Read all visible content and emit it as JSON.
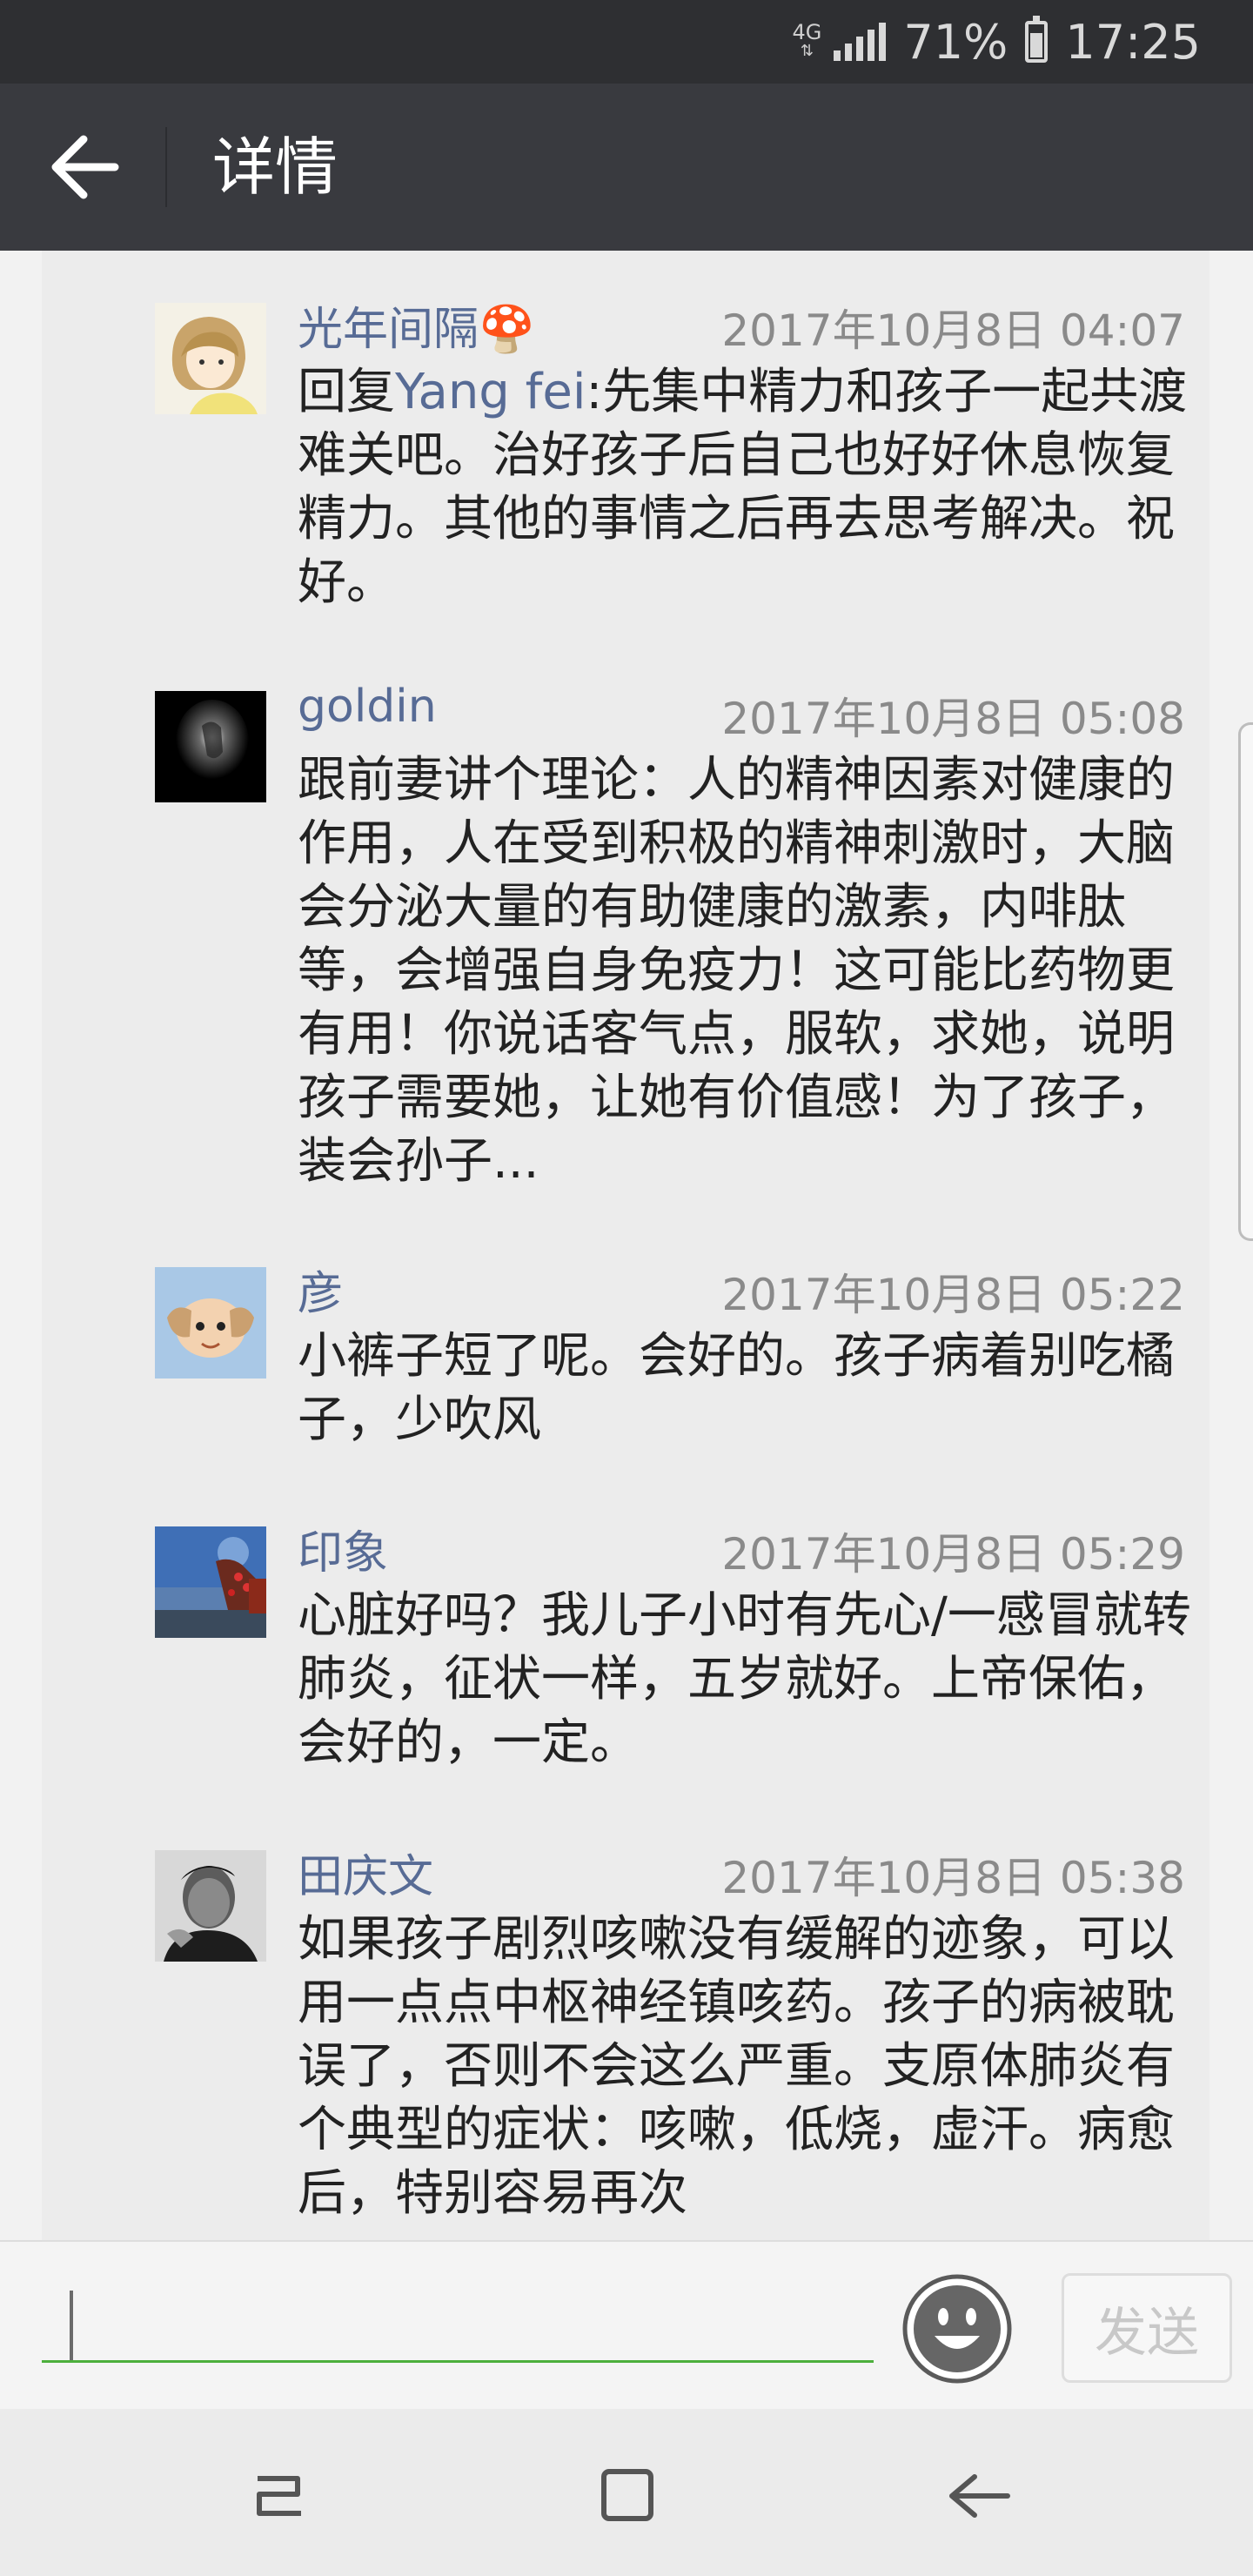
{
  "status_bar": {
    "network": "4G",
    "battery": "71%",
    "battery_level": 0.71,
    "time": "17:25"
  },
  "header": {
    "title": "详情"
  },
  "comments": [
    {
      "nickname": "光年间隔🍄",
      "time": "2017年10月8日 04:07",
      "reply_prefix": "回复",
      "reply_to": "Yang fei",
      "text": ":先集中精力和孩子一起共渡难关吧。治好孩子后自己也好好休息恢复精力。其他的事情之后再去思考解决。祝好。",
      "avatar": "cartoon-girl-avatar"
    },
    {
      "nickname": "goldin",
      "time": "2017年10月8日 05:08",
      "text": "跟前妻讲个理论：人的精神因素对健康的作用，人在受到积极的精神刺激时，大脑会分泌大量的有助健康的激素，内啡肽等，会增强自身免疫力！这可能比药物更有用！你说话客气点，服软，求她，说明孩子需要她，让她有价值感！为了孩子，装会孙子...",
      "avatar": "dark-hand-avatar"
    },
    {
      "nickname": "彦",
      "time": "2017年10月8日 05:22",
      "text": "小裤子短了呢。会好的。孩子病着别吃橘子，少吹风",
      "avatar": "cartoon-character-avatar"
    },
    {
      "nickname": "印象",
      "time": "2017年10月8日 05:29",
      "text": "心脏好吗？我儿子小时有先心/一感冒就转肺炎，征状一样，五岁就好。上帝保佑，会好的，一定。",
      "avatar": "landscape-avatar"
    },
    {
      "nickname": "田庆文",
      "time": "2017年10月8日 05:38",
      "text": "如果孩子剧烈咳嗽没有缓解的迹象，可以用一点点中枢神经镇咳药。孩子的病被耽误了，否则不会这么严重。支原体肺炎有个典型的症状：咳嗽，低烧，虚汗。病愈后，特别容易再次",
      "avatar": "man-portrait-avatar"
    }
  ],
  "input_bar": {
    "send_label": "发送",
    "emoji_icon": "smiley-icon"
  },
  "nav_bar": {
    "icons": [
      "recent-apps-icon",
      "home-icon",
      "back-icon"
    ]
  },
  "colors": {
    "status_bar": "#2e2f32",
    "title_bar": "#393a3f",
    "nickname": "#576b95",
    "input_underline": "#4caf3c"
  }
}
